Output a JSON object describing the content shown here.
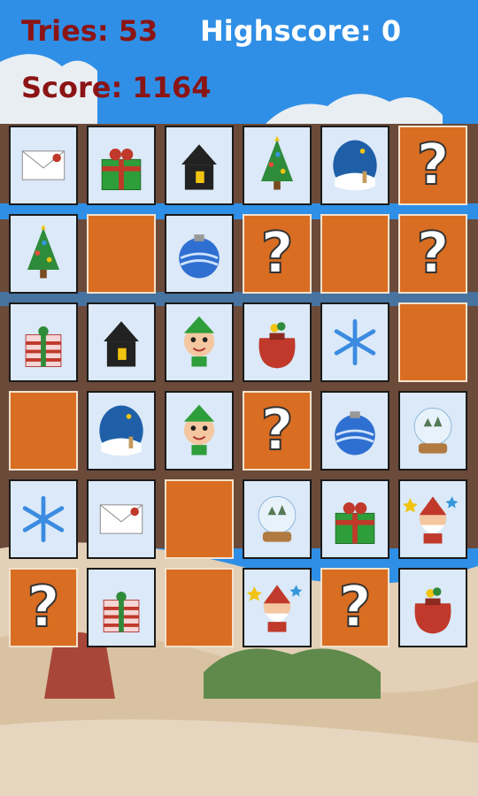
{
  "hud": {
    "tries_text": "Tries: 53",
    "highscore_text": "Highscore: 0",
    "score_text": "Score: 1164"
  },
  "colors": {
    "sky": "#2f8fe6",
    "hud_dark_red": "#8b1414",
    "hud_white": "#ffffff",
    "tile_back": "#d96d22",
    "tile_face": "#dbe9f8",
    "ground": "#e6d6bf"
  },
  "board": {
    "rows": 6,
    "cols": 6,
    "back_symbol": "?",
    "tiles": [
      [
        "letter-icon",
        "gift-box-icon",
        "house-icon",
        "christmas-tree-icon",
        "snowy-night-icon",
        "back"
      ],
      [
        "christmas-tree-icon",
        "empty",
        "ornament-icon",
        "back",
        "empty",
        "back"
      ],
      [
        "striped-gift-icon",
        "house-icon",
        "elf-icon",
        "sack-icon",
        "snowflake-icon",
        "empty"
      ],
      [
        "empty",
        "snowy-night-icon",
        "elf-icon",
        "back",
        "ornament-icon",
        "snow-globe-icon"
      ],
      [
        "snowflake-icon",
        "letter-icon",
        "empty",
        "snow-globe-icon",
        "gift-box-icon",
        "santa-icon"
      ],
      [
        "back",
        "striped-gift-icon",
        "empty",
        "santa-icon",
        "back",
        "sack-icon"
      ]
    ]
  }
}
